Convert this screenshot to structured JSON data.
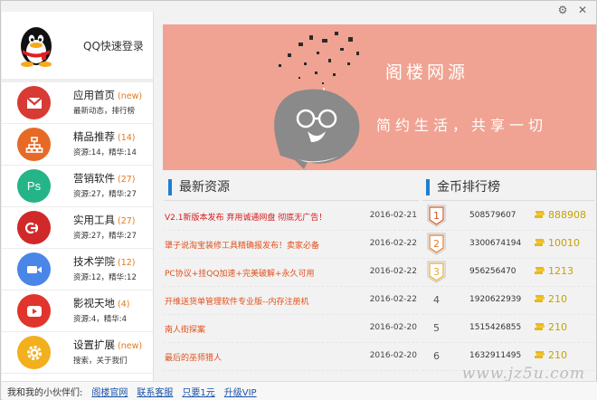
{
  "window": {
    "controls": [
      "⚙",
      "✕"
    ]
  },
  "login": {
    "label": "QQ快速登录"
  },
  "nav": [
    {
      "title": "应用首页",
      "count": "(new)",
      "sub": "最新动态，排行榜",
      "color": "#d83a34",
      "icon": "mail-icon"
    },
    {
      "title": "精品推荐",
      "count": "(14)",
      "sub": "资源:14，精华:14",
      "color": "#e66a26",
      "icon": "sitemap-icon"
    },
    {
      "title": "营销软件",
      "count": "(27)",
      "sub": "资源:27，精华:27",
      "color": "#24b487",
      "icon": "ps-icon"
    },
    {
      "title": "实用工具",
      "count": "(27)",
      "sub": "资源:27，精华:27",
      "color": "#d1282a",
      "icon": "adobe-cc-icon"
    },
    {
      "title": "技术学院",
      "count": "(12)",
      "sub": "资源:12，精华:12",
      "color": "#4a86e8",
      "icon": "video-icon"
    },
    {
      "title": "影视天地",
      "count": "(4)",
      "sub": "资源:4，精华:4",
      "color": "#e0342c",
      "icon": "play-icon"
    },
    {
      "title": "设置扩展",
      "count": "(new)",
      "sub": "搜索，关于我们",
      "color": "#f2b01e",
      "icon": "gear-icon"
    }
  ],
  "banner": {
    "title": "阁楼网源",
    "slogan": "简约生活，共享一切"
  },
  "resources": {
    "heading": "最新资源",
    "items": [
      {
        "title": "V2.1新版本发布 弃用诚通网盘 彻底无广告！",
        "date": "2016-02-21",
        "color": "#d8191b"
      },
      {
        "title": "犟子说淘宝装修工具精确报发布！卖家必备",
        "date": "2016-02-22",
        "color": "#e0511d"
      },
      {
        "title": "PC协议+挂QQ加速+完美破解+永久可用",
        "date": "2016-02-22",
        "color": "#e0511d"
      },
      {
        "title": "开维送货单管理软件专业版--内存注册机",
        "date": "2016-02-22",
        "color": "#e0511d"
      },
      {
        "title": "南人街探案",
        "date": "2016-02-20",
        "color": "#e0511d"
      },
      {
        "title": "最后的巫师猎人",
        "date": "2016-02-20",
        "color": "#e0511d"
      }
    ]
  },
  "ranking": {
    "heading": "金币排行榜",
    "items": [
      {
        "rank": "1",
        "id": "508579607",
        "score": "888908",
        "badge": "#d0562a"
      },
      {
        "rank": "2",
        "id": "3300674194",
        "score": "10010",
        "badge": "#e07a2a"
      },
      {
        "rank": "3",
        "id": "956256470",
        "score": "1213",
        "badge": "#e8a82a"
      },
      {
        "rank": "4",
        "id": "1920622939",
        "score": "210",
        "badge": ""
      },
      {
        "rank": "5",
        "id": "1515426855",
        "score": "210",
        "badge": ""
      },
      {
        "rank": "6",
        "id": "1632911495",
        "score": "210",
        "badge": ""
      }
    ]
  },
  "footer": {
    "label": "我和我的小伙伴们:",
    "links": [
      "阁楼官网",
      "联系客服",
      "只要1元",
      "升级VIP"
    ]
  },
  "watermark": "www.jz5u.com"
}
